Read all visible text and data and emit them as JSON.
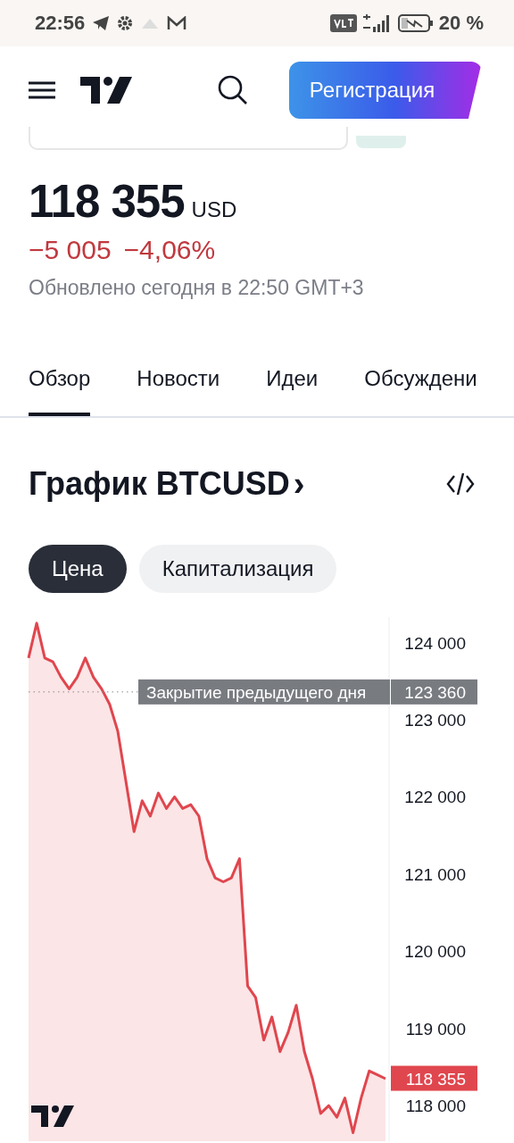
{
  "status_bar": {
    "time": "22:56",
    "battery": "20 %"
  },
  "header": {
    "register_button": "Регистрация"
  },
  "quote": {
    "price": "118 355",
    "currency": "USD",
    "change": "−5 005",
    "change_percent": "−4,06%",
    "updated": "Обновлено сегодня в 22:50 GMT+3"
  },
  "tabs": [
    {
      "label": "Обзор",
      "selected": true
    },
    {
      "label": "Новости",
      "selected": false
    },
    {
      "label": "Идеи",
      "selected": false
    },
    {
      "label": "Обсуждени",
      "selected": false
    }
  ],
  "chart": {
    "title": "График BTCUSD",
    "chevron": "›",
    "modes": [
      {
        "label": "Цена",
        "selected": true
      },
      {
        "label": "Капитализация",
        "selected": false
      }
    ],
    "previous_close": {
      "label": "Закрытие предыдущего дня",
      "value": "123 360"
    },
    "last_price": "118 355",
    "chart_data": {
      "type": "area",
      "ylim": [
        117540,
        124330
      ],
      "categories": [
        null,
        null,
        null,
        null,
        null,
        null,
        null,
        null,
        null,
        null,
        null,
        null,
        null,
        null,
        null,
        null,
        null,
        null,
        null,
        null,
        null,
        null,
        null,
        null,
        null,
        null,
        null,
        null,
        null,
        null,
        null,
        null,
        null,
        null,
        null,
        null,
        null,
        null,
        null,
        null,
        null,
        null,
        null,
        null,
        null
      ],
      "yticks": [
        {
          "value": 124000,
          "label": "124 000"
        },
        {
          "value": 123000,
          "label": "123 000"
        },
        {
          "value": 122000,
          "label": "122 000"
        },
        {
          "value": 121000,
          "label": "121 000"
        },
        {
          "value": 120000,
          "label": "120 000"
        },
        {
          "value": 119000,
          "label": "119 000"
        },
        {
          "value": 118000,
          "label": "118 000"
        }
      ],
      "series": [
        {
          "color": "#e0464e",
          "values": [
            123800,
            124250,
            123800,
            123750,
            123550,
            123400,
            123550,
            123800,
            123550,
            123400,
            123200,
            122850,
            122200,
            121550,
            121950,
            121750,
            122050,
            121850,
            122000,
            121850,
            121900,
            121750,
            121200,
            120950,
            120900,
            120950,
            121200,
            119550,
            119400,
            118850,
            119150,
            118700,
            118950,
            119300,
            118700,
            118350,
            117900,
            118000,
            117850,
            118100,
            117650,
            118100,
            118450,
            118400,
            118350
          ]
        }
      ]
    }
  }
}
